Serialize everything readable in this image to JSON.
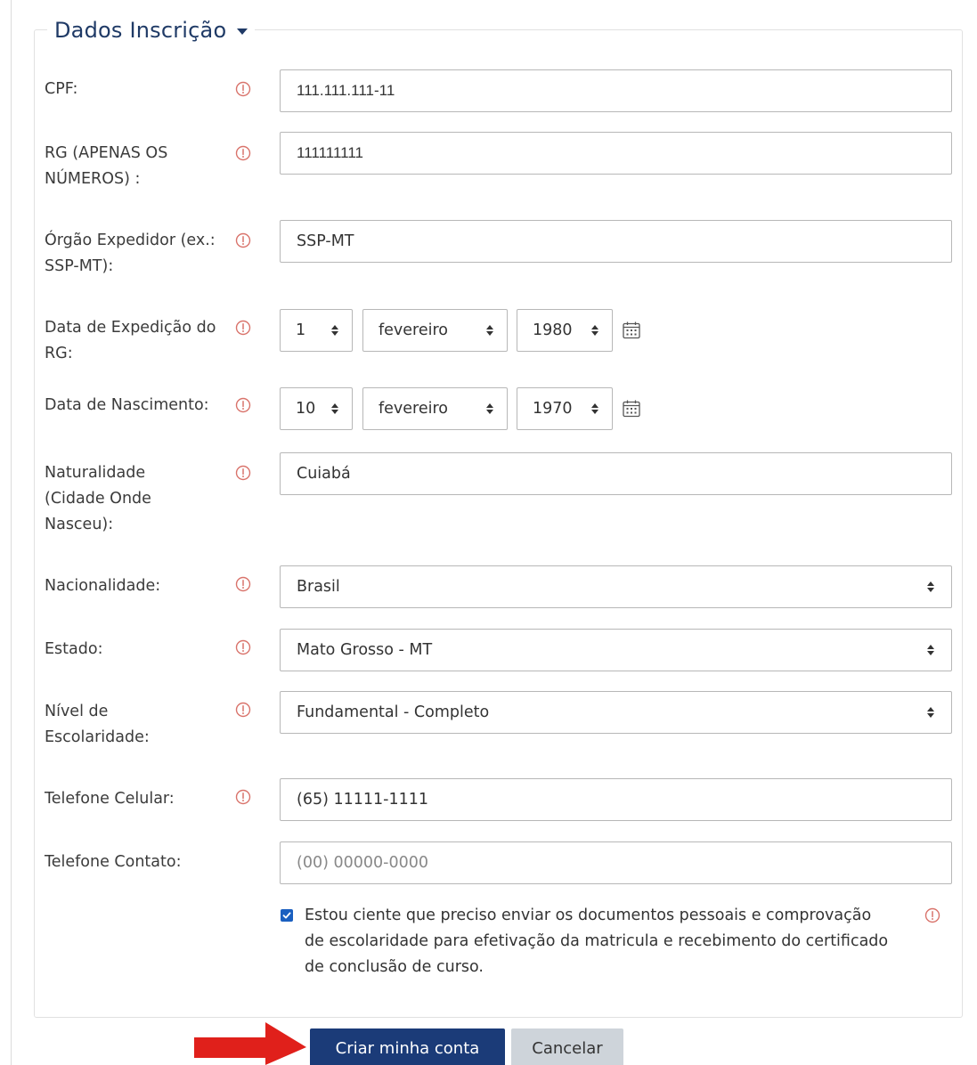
{
  "colors": {
    "legend": "#1f3a66",
    "required_icon": "#d9736b",
    "primary_button": "#1b3b78",
    "secondary_button": "#ced4da",
    "arrow": "#e0201b",
    "checkbox": "#1a5fc0"
  },
  "section": {
    "title": "Dados Inscrição",
    "toggle_icon": "caret-down-icon"
  },
  "required_icon": "exclamation-circle-icon",
  "fields": {
    "cpf": {
      "label": "CPF:",
      "value": "111.111.111-11"
    },
    "rg": {
      "label": "RG (APENAS OS NÚMEROS) :",
      "value": "111111111"
    },
    "orgao": {
      "label": "Órgão Expedidor (ex.: SSP-MT):",
      "value": "SSP-MT"
    },
    "data_expedicao": {
      "label": "Data de Expedição do RG:",
      "day": "1",
      "month": "fevereiro",
      "year": "1980",
      "calendar_icon": "calendar-icon"
    },
    "data_nascimento": {
      "label": "Data de Nascimento:",
      "day": "10",
      "month": "fevereiro",
      "year": "1970",
      "calendar_icon": "calendar-icon"
    },
    "naturalidade": {
      "label": "Naturalidade (Cidade Onde Nasceu):",
      "value": "Cuiabá"
    },
    "nacionalidade": {
      "label": "Nacionalidade:",
      "value": "Brasil"
    },
    "estado": {
      "label": "Estado:",
      "value": "Mato Grosso - MT"
    },
    "escolaridade": {
      "label": "Nível de Escolaridade:",
      "value": "Fundamental - Completo"
    },
    "celular": {
      "label": "Telefone Celular:",
      "value": "(65) 11111-1111"
    },
    "contato": {
      "label": "Telefone Contato:",
      "placeholder": "(00) 00000-0000"
    }
  },
  "acknowledgement": {
    "checked": true,
    "text": "Estou ciente que preciso enviar os documentos pessoais e comprovação de escolaridade para efetivação da matricula e recebimento do certificado de conclusão de curso."
  },
  "actions": {
    "submit": "Criar minha conta",
    "cancel": "Cancelar",
    "pointer": "arrow-right-icon"
  }
}
